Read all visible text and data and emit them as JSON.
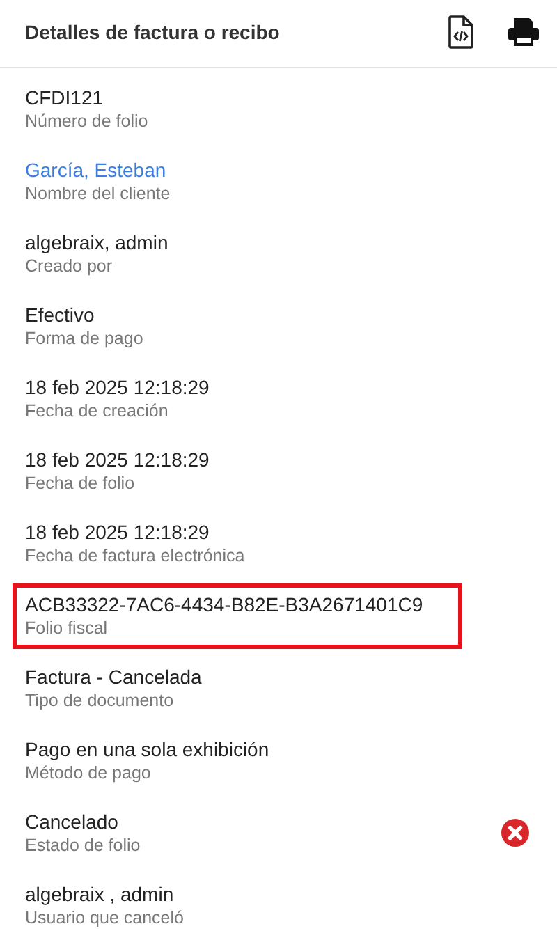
{
  "header": {
    "title": "Detalles de factura o recibo"
  },
  "fields": [
    {
      "value": "CFDI121",
      "label": "Número de folio",
      "kind": "text",
      "highlighted": false
    },
    {
      "value": "García, Esteban",
      "label": "Nombre del cliente",
      "kind": "link",
      "highlighted": false
    },
    {
      "value": "algebraix, admin",
      "label": "Creado por",
      "kind": "text",
      "highlighted": false
    },
    {
      "value": "Efectivo",
      "label": "Forma de pago",
      "kind": "text",
      "highlighted": false
    },
    {
      "value": "18 feb 2025 12:18:29",
      "label": "Fecha de creación",
      "kind": "text",
      "highlighted": false
    },
    {
      "value": "18 feb 2025 12:18:29",
      "label": "Fecha de folio",
      "kind": "text",
      "highlighted": false
    },
    {
      "value": "18 feb 2025 12:18:29",
      "label": "Fecha de factura electrónica",
      "kind": "text",
      "highlighted": false
    },
    {
      "value": "ACB33322-7AC6-4434-B82E-B3A2671401C9",
      "label": "Folio fiscal",
      "kind": "text",
      "highlighted": true
    },
    {
      "value": "Factura - Cancelada",
      "label": "Tipo de documento",
      "kind": "text",
      "highlighted": false
    },
    {
      "value": "Pago en una sola exhibición",
      "label": "Método de pago",
      "kind": "text",
      "highlighted": false
    },
    {
      "value": "Cancelado",
      "label": "Estado de folio",
      "kind": "cancelled-status",
      "highlighted": false
    },
    {
      "value": "algebraix , admin",
      "label": "Usuario que canceló",
      "kind": "text",
      "highlighted": false
    }
  ]
}
